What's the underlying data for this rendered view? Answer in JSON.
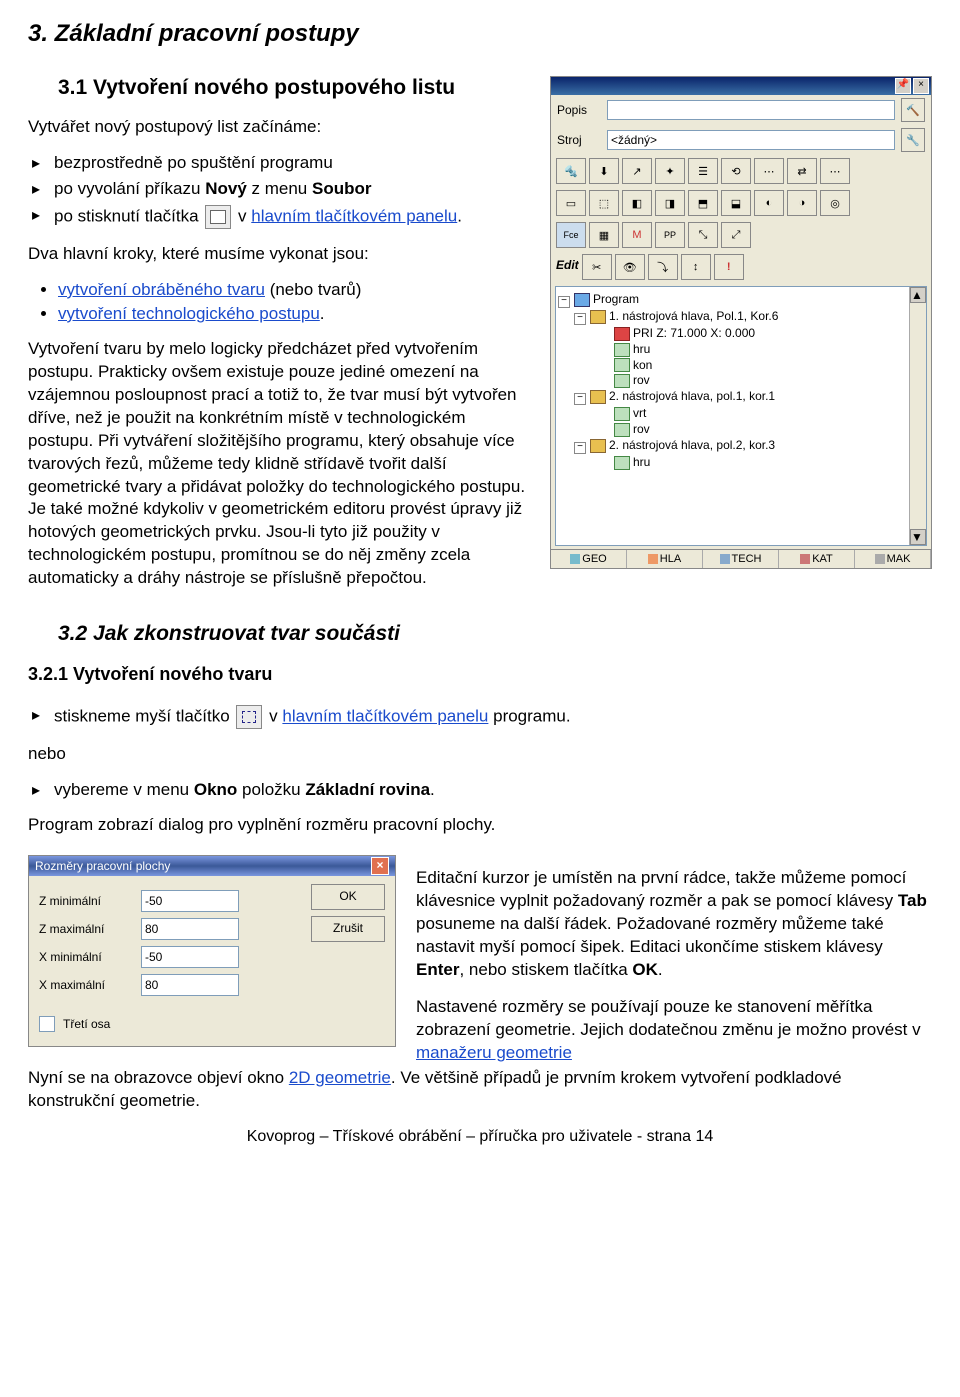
{
  "h1": "3. Základní pracovní postupy",
  "s31": {
    "heading": "3.1 Vytvoření nového postupového listu",
    "intro": "Vytvářet nový postupový list začínáme:",
    "bullets": {
      "b1": "bezprostředně po spuštění programu",
      "b2_pre": "po vyvolání příkazu ",
      "b2_b1": "Nový",
      "b2_mid": " z menu ",
      "b2_b2": "Soubor",
      "b3_pre": "po stisknutí tlačítka ",
      "b3_post_pre": " v ",
      "b3_link": "hlavním tlačítkovém panelu",
      "b3_post": "."
    },
    "steps_intro": "Dva hlavní kroky, které musíme vykonat jsou:",
    "steps": {
      "s1_link": "vytvoření obráběného tvaru",
      "s1_tail": " (nebo tvarů)",
      "s2_link": "vytvoření technologického postupu",
      "s2_tail": "."
    },
    "para": "Vytvoření tvaru by melo logicky předcházet před vytvořením postupu. Prakticky ovšem existuje pouze jediné omezení na vzájemnou posloupnost prací a totiž to, že tvar musí být vytvořen dříve, než je použit na konkrétním místě v technologickém postupu. Při vytváření složitějšího programu, který obsahuje více tvarových řezů, můžeme tedy klidně střídavě tvořit další geometrické tvary a přidávat položky do technologického postupu. Je také možné kdykoliv v geometrickém editoru provést úpravy již hotových geometrických prvku. Jsou-li tyto již použity v technologickém postupu, promítnou se do něj změny zcela automaticky a dráhy nástroje se příslušně přepočtou."
  },
  "s32": {
    "heading": "3.2 Jak zkonstruovat tvar součásti",
    "sub": "3.2.1 Vytvoření nového tvaru",
    "bul1_pre": "stiskneme myší tlačítko ",
    "bul1_mid": " v ",
    "bul1_link": "hlavním tlačítkovém panelu",
    "bul1_tail": " programu.",
    "nebo": "nebo",
    "bul2_pre": "vybereme v menu ",
    "bul2_b1": "Okno",
    "bul2_mid": " položku ",
    "bul2_b2": "Základní rovina",
    "bul2_tail": ".",
    "after": "Program zobrazí dialog pro vyplnění rozměru pracovní plochy.",
    "rhs_p1_a": "Editační kurzor je umístěn na první rádce, takže můžeme pomocí klávesnice vyplnit požadovaný rozměr a pak se pomocí klávesy ",
    "rhs_p1_tab": "Tab",
    "rhs_p1_b": " posuneme na další řádek. Požadované rozměry můžeme také nastavit myší pomocí šipek. Editaci ukončíme stiskem klávesy ",
    "rhs_p1_enter": "Enter",
    "rhs_p1_c": ", nebo stiskem tlačítka ",
    "rhs_p1_ok": "OK",
    "rhs_p1_d": ".",
    "rhs_p2_a": "Nastavené rozměry se používají pouze ke stanovení měřítka zobrazení geometrie. Jejich dodatečnou změnu je možno provést v ",
    "rhs_p2_link": "manažeru geometrie",
    "final_a": "Nyní se na obrazovce objeví okno ",
    "final_link": "2D geometrie",
    "final_b": ". Ve většině případů je prvním krokem vytvoření podkladové konstrukční geometrie."
  },
  "panel": {
    "popis": "Popis",
    "stroj": "Stroj",
    "stroj_val": "<žádný>",
    "edit": "Edit",
    "tree": {
      "program": "Program",
      "n1": "1. nástrojová hlava, Pol.1, Kor.6",
      "n1a": "PRI  Z:   71.000  X:   0.000",
      "n1b": "hru",
      "n1c": "kon",
      "n1d": "rov",
      "n2": "2. nástrojová hlava, pol.1, kor.1",
      "n2a": "vrt",
      "n2b": "rov",
      "n3": "2. nástrojová hlava, pol.2, kor.3",
      "n3a": "hru"
    },
    "tabs": {
      "geo": "GEO",
      "hla": "HLA",
      "tech": "TECH",
      "kat": "KAT",
      "mak": "MAK"
    }
  },
  "dialog": {
    "title": "Rozměry pracovní plochy",
    "zmin": "Z minimální",
    "zmin_v": "-50",
    "zmax": "Z maximální",
    "zmax_v": "80",
    "xmin": "X minimální",
    "xmin_v": "-50",
    "xmax": "X maximální",
    "xmax_v": "80",
    "ok": "OK",
    "cancel": "Zrušit",
    "third": "Třetí osa"
  },
  "footer": "Kovoprog – Třískové obrábění – příručka pro uživatele - strana 14"
}
